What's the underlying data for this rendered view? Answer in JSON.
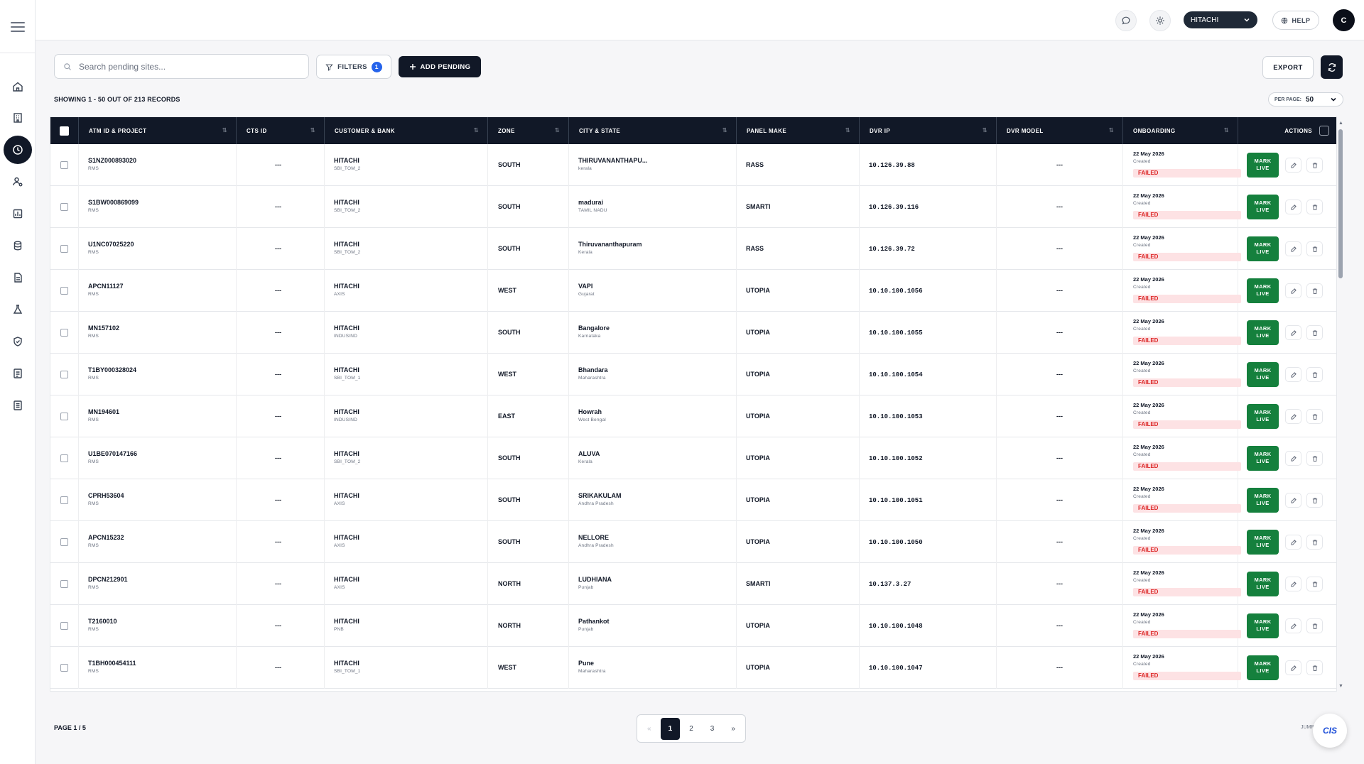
{
  "topbar": {
    "org": "HITACHI",
    "help": "HELP",
    "avatar": "C"
  },
  "toolbar": {
    "search_placeholder": "Search pending sites...",
    "filters_label": "FILTERS",
    "filters_count": "1",
    "add_label": "ADD PENDING",
    "export_label": "EXPORT"
  },
  "summary": {
    "records": "SHOWING 1 - 50 OUT OF 213 RECORDS",
    "per_page_label": "PER PAGE:",
    "per_page_value": "50"
  },
  "columns": [
    "ATM ID & PROJECT",
    "CTS ID",
    "CUSTOMER & BANK",
    "ZONE",
    "CITY & STATE",
    "PANEL MAKE",
    "DVR IP",
    "DVR MODEL",
    "ONBOARDING",
    "ACTIONS"
  ],
  "row_labels": {
    "created": "Created",
    "mark_live_1": "MARK",
    "mark_live_2": "LIVE"
  },
  "rows": [
    {
      "atm": "S1NZ000893020",
      "project": "RMS",
      "cts": "---",
      "customer": "HITACHI",
      "bank": "SBI_TOM_2",
      "zone": "SOUTH",
      "city": "THIRUVANANTHAPU...",
      "state": "kerala",
      "panel": "RASS",
      "ip": "10.126.39.88",
      "dvr": "---",
      "date": "22 May 2026",
      "status": "FAILED"
    },
    {
      "atm": "S1BW000869099",
      "project": "RMS",
      "cts": "---",
      "customer": "HITACHI",
      "bank": "SBI_TOM_2",
      "zone": "SOUTH",
      "city": "madurai",
      "state": "TAMIL NADU",
      "panel": "SMARTI",
      "ip": "10.126.39.116",
      "dvr": "---",
      "date": "22 May 2026",
      "status": "FAILED"
    },
    {
      "atm": "U1NC07025220",
      "project": "RMS",
      "cts": "---",
      "customer": "HITACHI",
      "bank": "SBI_TOM_2",
      "zone": "SOUTH",
      "city": "Thiruvananthapuram",
      "state": "Kerala",
      "panel": "RASS",
      "ip": "10.126.39.72",
      "dvr": "---",
      "date": "22 May 2026",
      "status": "FAILED"
    },
    {
      "atm": "APCN11127",
      "project": "RMS",
      "cts": "---",
      "customer": "HITACHI",
      "bank": "AXIS",
      "zone": "WEST",
      "city": "VAPI",
      "state": "Gujarat",
      "panel": "UTOPIA",
      "ip": "10.10.100.1056",
      "dvr": "---",
      "date": "22 May 2026",
      "status": "FAILED"
    },
    {
      "atm": "MN157102",
      "project": "RMS",
      "cts": "---",
      "customer": "HITACHI",
      "bank": "INDUSIND",
      "zone": "SOUTH",
      "city": "Bangalore",
      "state": "Karnataka",
      "panel": "UTOPIA",
      "ip": "10.10.100.1055",
      "dvr": "---",
      "date": "22 May 2026",
      "status": "FAILED"
    },
    {
      "atm": "T1BY000328024",
      "project": "RMS",
      "cts": "---",
      "customer": "HITACHI",
      "bank": "SBI_TOM_1",
      "zone": "WEST",
      "city": "Bhandara",
      "state": "Maharashtra",
      "panel": "UTOPIA",
      "ip": "10.10.100.1054",
      "dvr": "---",
      "date": "22 May 2026",
      "status": "FAILED"
    },
    {
      "atm": "MN194601",
      "project": "RMS",
      "cts": "---",
      "customer": "HITACHI",
      "bank": "INDUSIND",
      "zone": "EAST",
      "city": "Howrah",
      "state": "West Bengal",
      "panel": "UTOPIA",
      "ip": "10.10.100.1053",
      "dvr": "---",
      "date": "22 May 2026",
      "status": "FAILED"
    },
    {
      "atm": "U1BE070147166",
      "project": "RMS",
      "cts": "---",
      "customer": "HITACHI",
      "bank": "SBI_TOM_2",
      "zone": "SOUTH",
      "city": "ALUVA",
      "state": "Kerala",
      "panel": "UTOPIA",
      "ip": "10.10.100.1052",
      "dvr": "---",
      "date": "22 May 2026",
      "status": "FAILED"
    },
    {
      "atm": "CPRH53604",
      "project": "RMS",
      "cts": "---",
      "customer": "HITACHI",
      "bank": "AXIS",
      "zone": "SOUTH",
      "city": "SRIKAKULAM",
      "state": "Andhra Pradesh",
      "panel": "UTOPIA",
      "ip": "10.10.100.1051",
      "dvr": "---",
      "date": "22 May 2026",
      "status": "FAILED"
    },
    {
      "atm": "APCN15232",
      "project": "RMS",
      "cts": "---",
      "customer": "HITACHI",
      "bank": "AXIS",
      "zone": "SOUTH",
      "city": "NELLORE",
      "state": "Andhra Pradesh",
      "panel": "UTOPIA",
      "ip": "10.10.100.1050",
      "dvr": "---",
      "date": "22 May 2026",
      "status": "FAILED"
    },
    {
      "atm": "DPCN212901",
      "project": "RMS",
      "cts": "---",
      "customer": "HITACHI",
      "bank": "AXIS",
      "zone": "NORTH",
      "city": "LUDHIANA",
      "state": "Punjab",
      "panel": "SMARTI",
      "ip": "10.137.3.27",
      "dvr": "---",
      "date": "22 May 2026",
      "status": "FAILED"
    },
    {
      "atm": "T2160010",
      "project": "RMS",
      "cts": "---",
      "customer": "HITACHI",
      "bank": "PNB",
      "zone": "NORTH",
      "city": "Pathankot",
      "state": "Punjab",
      "panel": "UTOPIA",
      "ip": "10.10.100.1048",
      "dvr": "---",
      "date": "22 May 2026",
      "status": "FAILED"
    },
    {
      "atm": "T1BH000454111",
      "project": "RMS",
      "cts": "---",
      "customer": "HITACHI",
      "bank": "SBI_TOM_1",
      "zone": "WEST",
      "city": "Pune",
      "state": "Maharashtra",
      "panel": "UTOPIA",
      "ip": "10.10.100.1047",
      "dvr": "---",
      "date": "22 May 2026",
      "status": "FAILED"
    }
  ],
  "footer": {
    "page_label": "PAGE 1 / 5",
    "pages": [
      "1",
      "2",
      "3"
    ],
    "prev": "«",
    "next": "»",
    "jump_label": "JUMP",
    "fab_label": "CIS"
  }
}
